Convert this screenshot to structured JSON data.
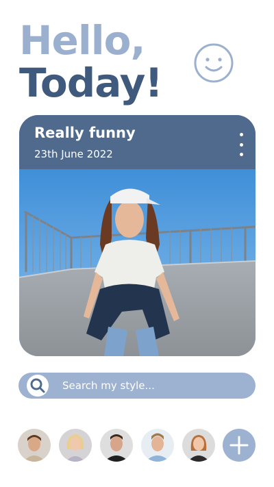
{
  "greeting": {
    "line1": "Hello,",
    "line2": "Today!"
  },
  "card": {
    "title": "Really funny",
    "date": "23th June 2022"
  },
  "search": {
    "placeholder": "Search my style..."
  },
  "avatars": [
    {
      "name": "avatar-1"
    },
    {
      "name": "avatar-2"
    },
    {
      "name": "avatar-3"
    },
    {
      "name": "avatar-4"
    },
    {
      "name": "avatar-5"
    }
  ],
  "colors": {
    "accent_light": "#9bb0cf",
    "accent_dark": "#3f5a7d",
    "card_header": "#4f6a8c",
    "search_bg": "#9db1d0"
  },
  "icons": [
    "smiley-icon",
    "more-vertical-icon",
    "search-icon",
    "plus-icon"
  ]
}
